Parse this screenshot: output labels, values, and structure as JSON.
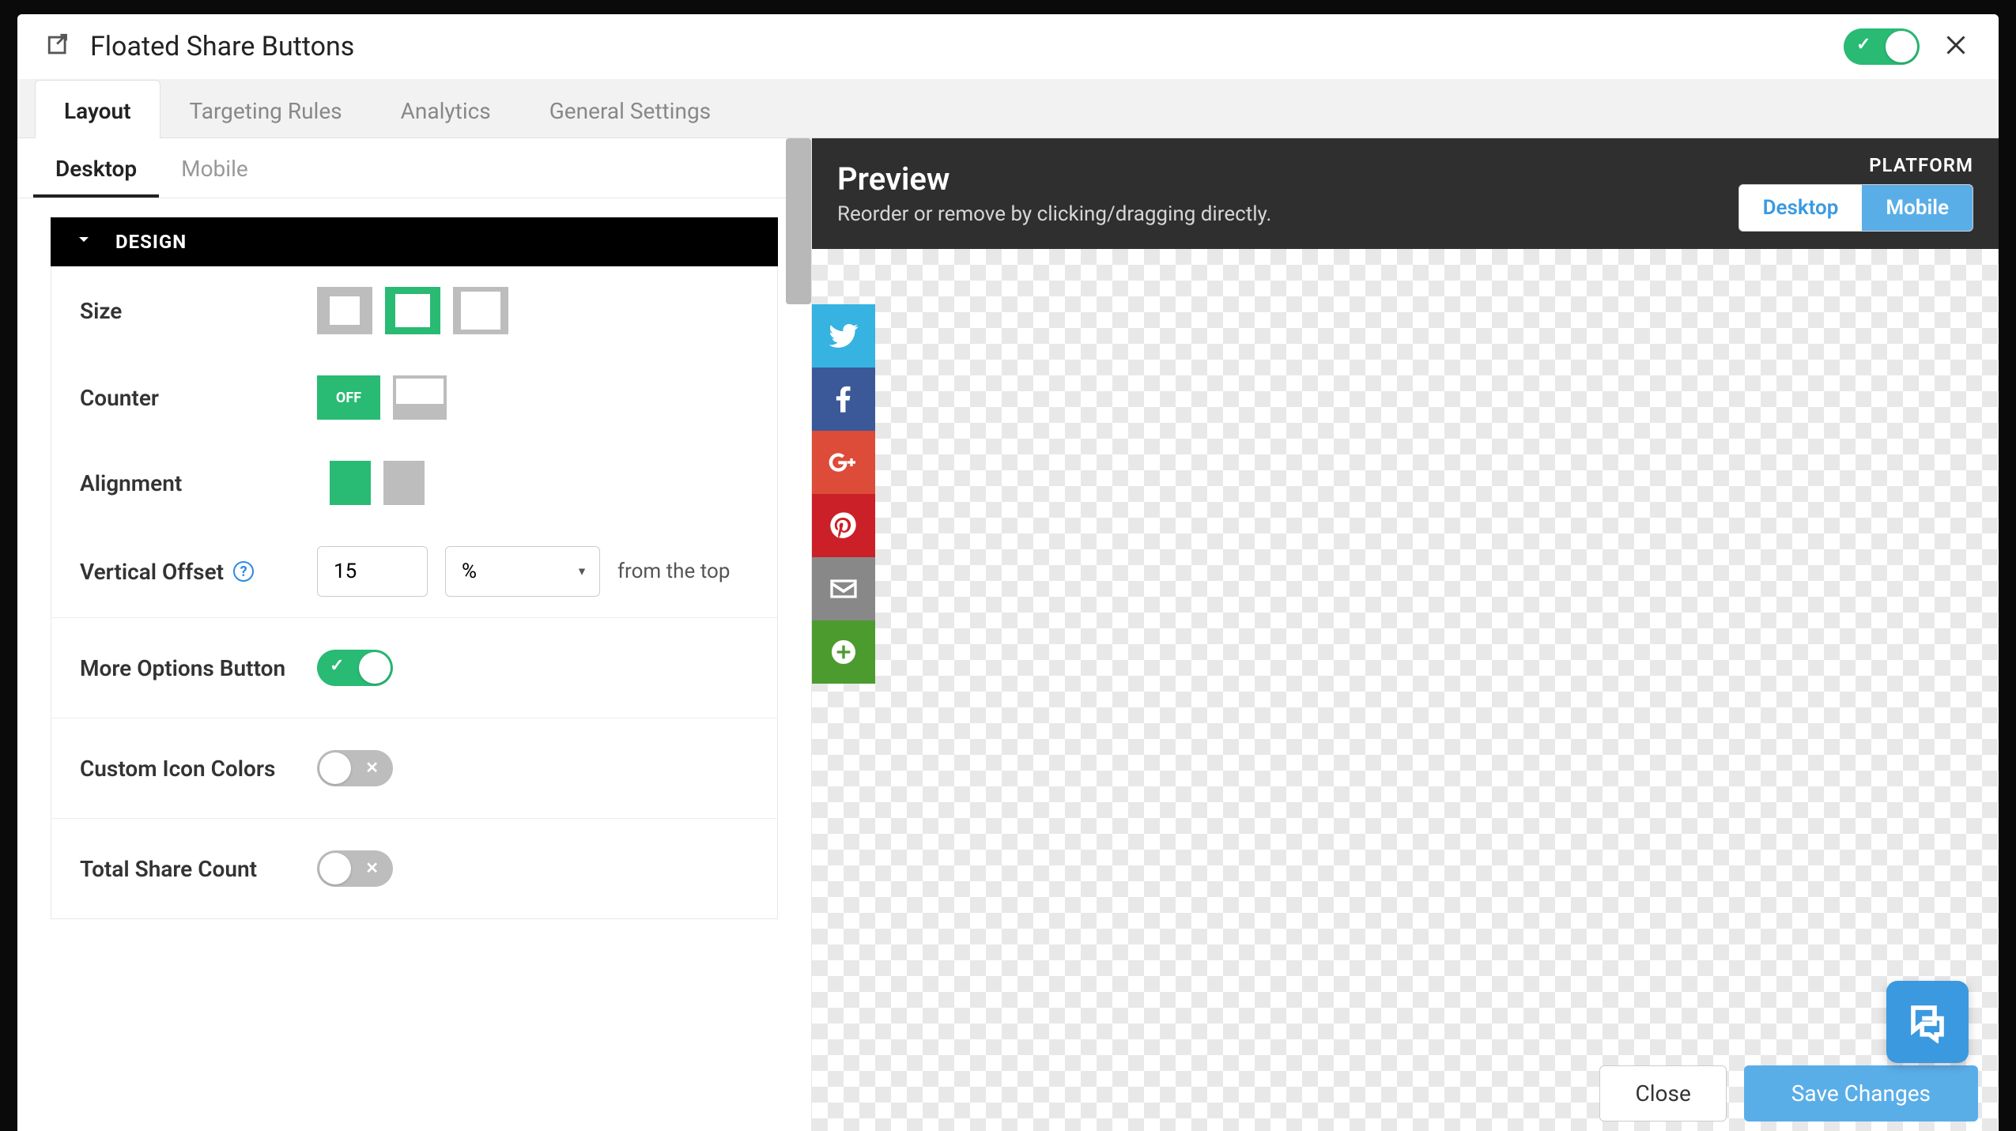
{
  "header": {
    "title": "Floated Share Buttons",
    "enabled": true
  },
  "tabs": [
    {
      "label": "Layout",
      "active": true
    },
    {
      "label": "Targeting Rules",
      "active": false
    },
    {
      "label": "Analytics",
      "active": false
    },
    {
      "label": "General Settings",
      "active": false
    }
  ],
  "device_tabs": [
    {
      "label": "Desktop",
      "active": true
    },
    {
      "label": "Mobile",
      "active": false
    }
  ],
  "design": {
    "section_title": "DESIGN",
    "size": {
      "label": "Size",
      "selected": "medium"
    },
    "counter": {
      "label": "Counter",
      "off_label": "OFF",
      "selected": "off"
    },
    "alignment": {
      "label": "Alignment",
      "selected": "left"
    },
    "vertical_offset": {
      "label": "Vertical Offset",
      "value": "15",
      "unit": "%",
      "suffix": "from the top"
    },
    "more_options": {
      "label": "More Options Button",
      "value": true
    },
    "custom_colors": {
      "label": "Custom Icon Colors",
      "value": false
    },
    "total_share": {
      "label": "Total Share Count",
      "value": false
    }
  },
  "preview": {
    "title": "Preview",
    "subtitle": "Reorder or remove by clicking/dragging directly.",
    "platform_label": "PLATFORM",
    "seg_desktop": "Desktop",
    "seg_mobile": "Mobile",
    "share_buttons": [
      {
        "name": "twitter",
        "color": "#36b3e1"
      },
      {
        "name": "facebook",
        "color": "#3b5998"
      },
      {
        "name": "google",
        "color": "#dd4b39"
      },
      {
        "name": "pinterest",
        "color": "#cb2027"
      },
      {
        "name": "email",
        "color": "#888888"
      },
      {
        "name": "more",
        "color": "#4c9b2f"
      }
    ]
  },
  "footer": {
    "close": "Close",
    "save": "Save Changes"
  }
}
